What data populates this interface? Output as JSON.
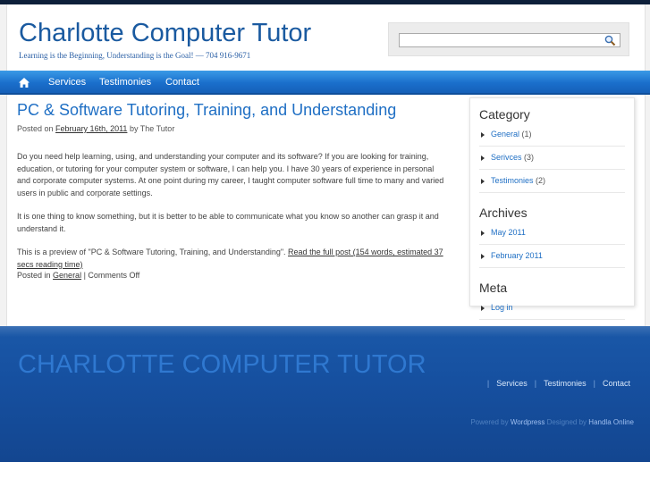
{
  "header": {
    "site_title": "Charlotte Computer Tutor",
    "tagline": "Learning is the Beginning, Understanding is the Goal! — 704 916-9671",
    "search": {
      "value": "",
      "placeholder": ""
    }
  },
  "nav": {
    "home_icon": "home-icon",
    "items": [
      {
        "label": "Services"
      },
      {
        "label": "Testimonies"
      },
      {
        "label": "Contact"
      }
    ]
  },
  "post": {
    "title": "PC & Software Tutoring, Training, and Understanding",
    "meta_prefix": "Posted on",
    "date": "February 16th, 2011",
    "meta_by": "by The Tutor",
    "paragraphs": [
      "Do you need help learning, using, and understanding your computer and its software?  If you are looking for training, education, or tutoring for your computer system or software, I can help you.  I have 30 years of experience in personal and corporate computer systems.  At one point during my career, I taught computer software full time to many and varied users in public and corporate settings.",
      "It is one thing to know something, but it is better to be able to communicate what you know so another can grasp it and understand it."
    ],
    "preview_prefix": "This is a preview of \"PC & Software Tutoring, Training, and Understanding\". ",
    "read_more": "Read the full post (154 words, estimated 37 secs reading time)",
    "posted_in_prefix": "Posted in",
    "category": "General",
    "comments": "| Comments Off"
  },
  "sidebar": {
    "category_heading": "Category",
    "categories": [
      {
        "label": "General",
        "count": "(1)"
      },
      {
        "label": "Serivces",
        "count": "(3)"
      },
      {
        "label": "Testimonies",
        "count": "(2)"
      }
    ],
    "archives_heading": "Archives",
    "archives": [
      {
        "label": "May 2011"
      },
      {
        "label": "February 2011"
      }
    ],
    "meta_heading": "Meta",
    "meta": [
      {
        "label": "Log in"
      }
    ]
  },
  "footer": {
    "title": "CHARLOTTE COMPUTER TUTOR",
    "sep": "|",
    "links": [
      {
        "label": "Services"
      },
      {
        "label": "Testimonies"
      },
      {
        "label": "Contact"
      }
    ],
    "powered_prefix": "Powered by",
    "powered_link": "Wordpress",
    "designed_prefix": "Designed by",
    "designed_link": "Handla Online"
  },
  "colors": {
    "accent": "#1f6fc4",
    "nav_bar": "#1a6fcc",
    "footer_bg": "#1650a0"
  }
}
